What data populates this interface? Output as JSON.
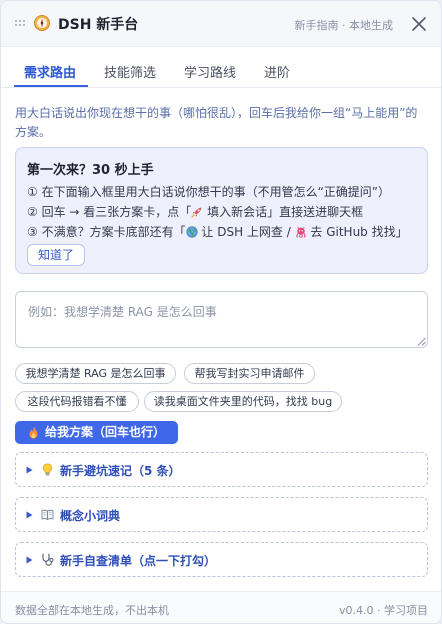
{
  "header": {
    "title": "DSH 新手台",
    "hint": "新手指南 · 本地生成",
    "icons": {
      "drag": "drag-grip-icon",
      "logo": "compass-icon",
      "close": "close-icon"
    }
  },
  "tabs": [
    {
      "label": "需求路由",
      "active": true
    },
    {
      "label": "技能筛选",
      "active": false
    },
    {
      "label": "学习路线",
      "active": false
    },
    {
      "label": "进阶",
      "active": false
    }
  ],
  "intro": "用大白话说出你现在想干的事（哪怕很乱），回车后我给你一组“马上能用”的方案。",
  "onboarding": {
    "title": "第一次来？30 秒上手",
    "step1": "① 在下面输入框里用大白话说你想干的事（不用管怎么“正确提问”）",
    "step2_a": "② 回车 → 看三张方案卡，点「",
    "step2_b": " 填入新会话」直接送进聊天框",
    "step3_a": "③ 不满意？方案卡底部还有「",
    "step3_b": " 让 DSH 上网查 / ",
    "step3_c": " 去 GitHub 找找」",
    "dismiss": "知道了",
    "icons": [
      "rocket-icon",
      "globe-icon",
      "octocat-icon"
    ]
  },
  "query": {
    "placeholder": "例如：我想学清楚 RAG 是怎么回事",
    "value": ""
  },
  "suggestions": [
    "我想学清楚 RAG 是怎么回事",
    "帮我写封实习申请邮件",
    "这段代码报错看不懂",
    "读我桌面文件夹里的代码，找找 bug"
  ],
  "primary_button": {
    "label": "给我方案（回车也行）",
    "icon": "flame-icon"
  },
  "sections": [
    {
      "title": "新手避坑速记（5 条）",
      "icon": "lightbulb-icon"
    },
    {
      "title": "概念小词典",
      "icon": "book-icon"
    },
    {
      "title": "新手自查清单（点一下打勾）",
      "icon": "stethoscope-icon"
    }
  ],
  "footer": {
    "left": "数据全部在本地生成，不出本机",
    "right": "v0.4.0 · 学习项目"
  },
  "colors": {
    "accent": "#3e68e8",
    "card_bg": "#eef1fb",
    "link": "#2e4fb8"
  }
}
